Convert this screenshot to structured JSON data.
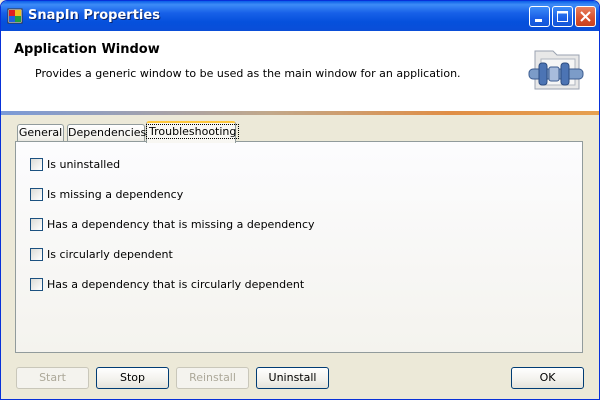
{
  "window": {
    "title": "SnapIn Properties",
    "accent_color": "#0a5ee8"
  },
  "header": {
    "title": "Application Window",
    "description": "Provides a generic window to be used as the main window for an application.",
    "icon": "snapin-folder-icon"
  },
  "tabs": [
    {
      "label": "General",
      "selected": false
    },
    {
      "label": "Dependencies",
      "selected": false
    },
    {
      "label": "Troubleshooting",
      "selected": true
    }
  ],
  "checks": [
    {
      "label": "Is uninstalled",
      "checked": false
    },
    {
      "label": "Is missing a dependency",
      "checked": false
    },
    {
      "label": "Has a dependency that is missing a dependency",
      "checked": false
    },
    {
      "label": "Is circularly dependent",
      "checked": false
    },
    {
      "label": "Has a dependency that is circularly dependent",
      "checked": false
    }
  ],
  "buttons": {
    "start": {
      "label": "Start",
      "enabled": false
    },
    "stop": {
      "label": "Stop",
      "enabled": true
    },
    "reinstall": {
      "label": "Reinstall",
      "enabled": false
    },
    "uninstall": {
      "label": "Uninstall",
      "enabled": true
    },
    "ok": {
      "label": "OK",
      "enabled": true
    }
  }
}
